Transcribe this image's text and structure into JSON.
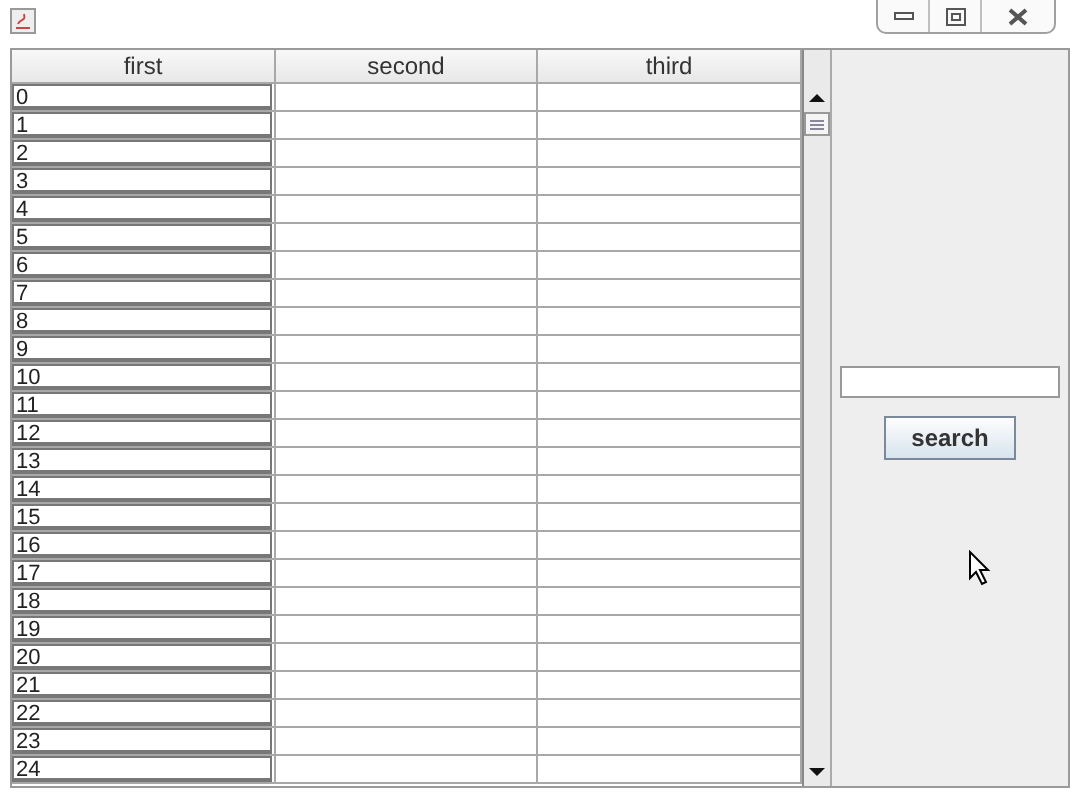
{
  "window": {
    "controls": [
      {
        "kind": "minimize"
      },
      {
        "kind": "maximize"
      },
      {
        "kind": "close"
      }
    ]
  },
  "table": {
    "columns": [
      "first",
      "second",
      "third"
    ],
    "rows": [
      {
        "first": "0"
      },
      {
        "first": "1"
      },
      {
        "first": "2"
      },
      {
        "first": "3"
      },
      {
        "first": "4"
      },
      {
        "first": "5"
      },
      {
        "first": "6"
      },
      {
        "first": "7"
      },
      {
        "first": "8"
      },
      {
        "first": "9"
      },
      {
        "first": "10"
      },
      {
        "first": "11"
      },
      {
        "first": "12"
      },
      {
        "first": "13"
      },
      {
        "first": "14"
      },
      {
        "first": "15"
      },
      {
        "first": "16"
      },
      {
        "first": "17"
      },
      {
        "first": "18"
      },
      {
        "first": "19"
      },
      {
        "first": "20"
      },
      {
        "first": "21"
      },
      {
        "first": "22"
      },
      {
        "first": "23"
      },
      {
        "first": "24"
      }
    ]
  },
  "search": {
    "button": "search"
  }
}
